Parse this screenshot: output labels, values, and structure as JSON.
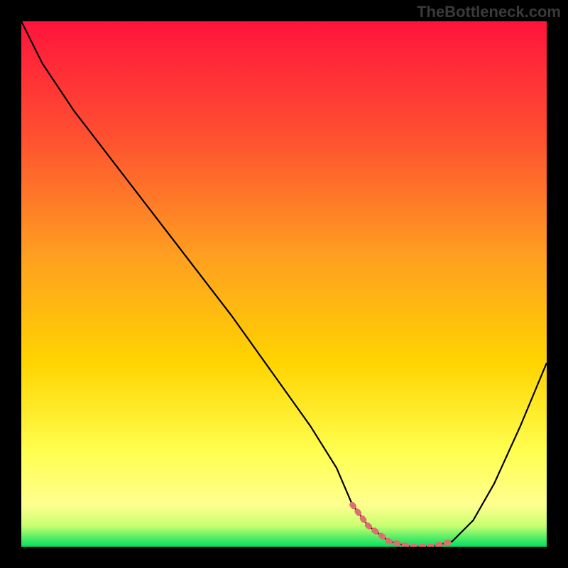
{
  "watermark": "TheBottleneck.com",
  "chart_data": {
    "type": "line",
    "title": "",
    "xlabel": "",
    "ylabel": "",
    "xlim": [
      0,
      100
    ],
    "ylim": [
      0,
      100
    ],
    "gradient": {
      "top_color": "#ff143c",
      "mid_color": "#ffd400",
      "lower_color": "#ffff78",
      "bottom_color": "#00e060"
    },
    "series": [
      {
        "name": "curve",
        "color": "#000000",
        "x": [
          0,
          4,
          10,
          20,
          30,
          40,
          50,
          55,
          60,
          63,
          66,
          70,
          74,
          78,
          82,
          86,
          90,
          95,
          100
        ],
        "y": [
          100,
          92,
          83,
          70,
          57,
          44,
          30,
          23,
          15,
          8,
          4,
          1,
          0,
          0,
          1,
          5,
          12,
          23,
          35
        ]
      },
      {
        "name": "bottleneck-highlight",
        "color": "#e07878",
        "x": [
          63,
          66,
          70,
          74,
          78,
          82
        ],
        "y": [
          8,
          4,
          1,
          0,
          0,
          1
        ]
      }
    ]
  }
}
